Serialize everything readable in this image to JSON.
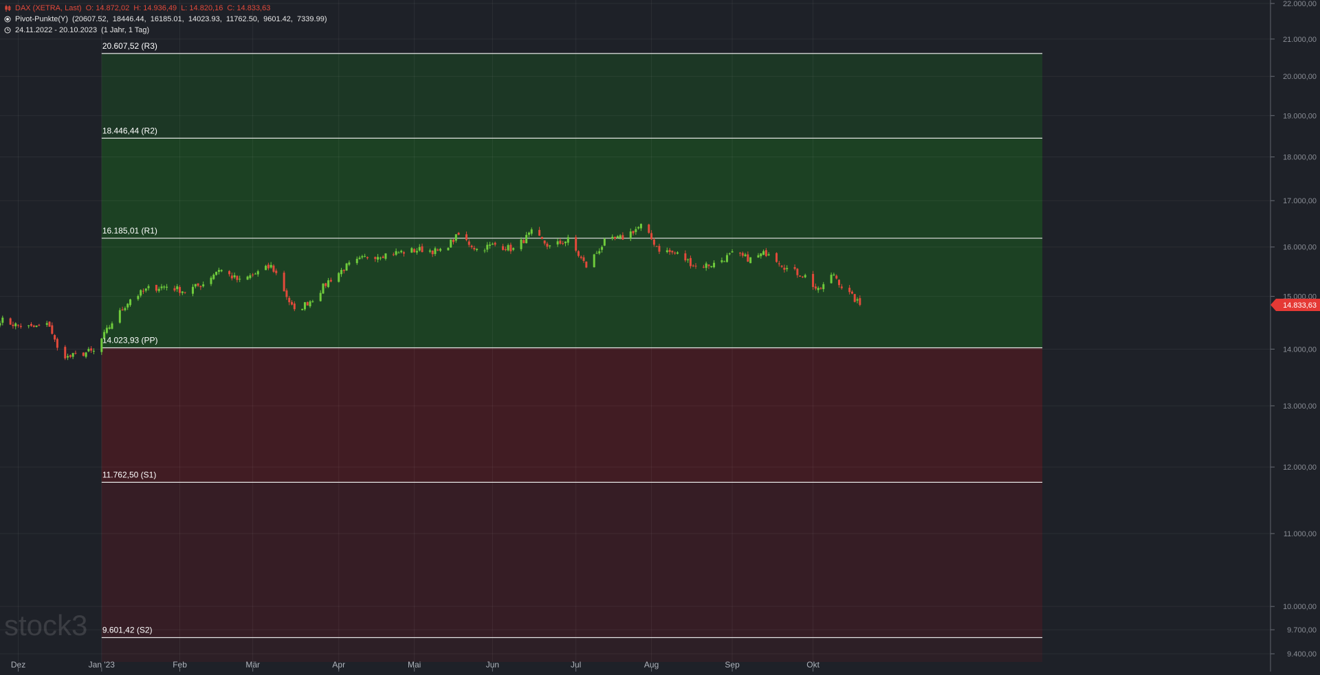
{
  "legend": {
    "instrument": "DAX (XETRA, Last)",
    "open": "O: 14.872,02",
    "high": "H: 14.936,49",
    "low": "L: 14.820,16",
    "close": "C: 14.833,63",
    "indicator": "Pivot-Punkte(Y)",
    "indicator_values": "(20607.52,  18446.44,  16185.01,  14023.93,  11762.50,  9601.42,  7339.99)",
    "range": "24.11.2022 - 20.10.2023",
    "range_detail": "(1 Jahr, 1 Tag)"
  },
  "watermark": "stock3",
  "colors": {
    "background": "#1e2128",
    "up": "#6fcb3c",
    "down": "#e24a3b",
    "resistance_zone": "#1c4a22",
    "support_zone": "#4a1c22"
  },
  "chart_data": {
    "type": "candlestick",
    "y_scale": "log",
    "ylim": [
      9300,
      22100
    ],
    "yticks": [
      {
        "value": 9400,
        "label": "9.400,00"
      },
      {
        "value": 9700,
        "label": "9.700,00"
      },
      {
        "value": 10000,
        "label": "10.000,00"
      },
      {
        "value": 11000,
        "label": "11.000,00"
      },
      {
        "value": 12000,
        "label": "12.000,00"
      },
      {
        "value": 13000,
        "label": "13.000,00"
      },
      {
        "value": 14000,
        "label": "14.000,00"
      },
      {
        "value": 15000,
        "label": "15.000,00"
      },
      {
        "value": 16000,
        "label": "16.000,00"
      },
      {
        "value": 17000,
        "label": "17.000,00"
      },
      {
        "value": 18000,
        "label": "18.000,00"
      },
      {
        "value": 19000,
        "label": "19.000,00"
      },
      {
        "value": 20000,
        "label": "20.000,00"
      },
      {
        "value": 21000,
        "label": "21.000,00"
      },
      {
        "value": 22000,
        "label": "22.000,00"
      }
    ],
    "xlim": [
      "2022-11-24",
      "2024-03-15"
    ],
    "xticks": [
      {
        "date": "2022-12-01",
        "label": "Dez"
      },
      {
        "date": "2023-01-02",
        "label": "Jan '23"
      },
      {
        "date": "2023-02-01",
        "label": "Feb"
      },
      {
        "date": "2023-03-01",
        "label": "Mär"
      },
      {
        "date": "2023-04-03",
        "label": "Apr"
      },
      {
        "date": "2023-05-02",
        "label": "Mai"
      },
      {
        "date": "2023-06-01",
        "label": "Jun"
      },
      {
        "date": "2023-07-03",
        "label": "Jul"
      },
      {
        "date": "2023-08-01",
        "label": "Aug"
      },
      {
        "date": "2023-09-01",
        "label": "Sep"
      },
      {
        "date": "2023-10-02",
        "label": "Okt"
      }
    ],
    "last_price": {
      "value": 14833.63,
      "label": "14.833,63"
    },
    "pivot_period": [
      "2023-01-02",
      "2023-12-29"
    ],
    "pivots": [
      {
        "value": 20607.52,
        "label": "20.607,52 (R3)"
      },
      {
        "value": 18446.44,
        "label": "18.446,44 (R2)"
      },
      {
        "value": 16185.01,
        "label": "16.185,01 (R1)"
      },
      {
        "value": 14023.93,
        "label": "14.023,93 (PP)"
      },
      {
        "value": 11762.5,
        "label": "11.762,50 (S1)"
      },
      {
        "value": 9601.42,
        "label": "9.601,42 (S2)"
      }
    ],
    "series": [
      {
        "date": "2022-11-24",
        "close": 14550
      },
      {
        "date": "2022-11-30",
        "close": 14450
      },
      {
        "date": "2022-12-06",
        "close": 14400
      },
      {
        "date": "2022-12-13",
        "close": 14450
      },
      {
        "date": "2022-12-16",
        "close": 14000
      },
      {
        "date": "2022-12-20",
        "close": 13850
      },
      {
        "date": "2022-12-28",
        "close": 13950
      },
      {
        "date": "2022-12-30",
        "close": 13950
      },
      {
        "date": "2023-01-06",
        "close": 14500
      },
      {
        "date": "2023-01-10",
        "close": 14750
      },
      {
        "date": "2023-01-13",
        "close": 14950
      },
      {
        "date": "2023-01-20",
        "close": 15150
      },
      {
        "date": "2023-01-27",
        "close": 15200
      },
      {
        "date": "2023-02-03",
        "close": 15100
      },
      {
        "date": "2023-02-10",
        "close": 15250
      },
      {
        "date": "2023-02-16",
        "close": 15550
      },
      {
        "date": "2023-02-24",
        "close": 15300
      },
      {
        "date": "2023-03-02",
        "close": 15450
      },
      {
        "date": "2023-03-08",
        "close": 15600
      },
      {
        "date": "2023-03-10",
        "close": 15450
      },
      {
        "date": "2023-03-15",
        "close": 14900
      },
      {
        "date": "2023-03-17",
        "close": 14700
      },
      {
        "date": "2023-03-24",
        "close": 14950
      },
      {
        "date": "2023-03-30",
        "close": 15300
      },
      {
        "date": "2023-04-06",
        "close": 15600
      },
      {
        "date": "2023-04-14",
        "close": 15800
      },
      {
        "date": "2023-04-21",
        "close": 15850
      },
      {
        "date": "2023-04-28",
        "close": 15900
      },
      {
        "date": "2023-05-05",
        "close": 15950
      },
      {
        "date": "2023-05-12",
        "close": 15900
      },
      {
        "date": "2023-05-19",
        "close": 16250
      },
      {
        "date": "2023-05-26",
        "close": 15950
      },
      {
        "date": "2023-06-02",
        "close": 16050
      },
      {
        "date": "2023-06-09",
        "close": 15950
      },
      {
        "date": "2023-06-16",
        "close": 16300
      },
      {
        "date": "2023-06-23",
        "close": 16000
      },
      {
        "date": "2023-06-30",
        "close": 16150
      },
      {
        "date": "2023-07-07",
        "close": 15600
      },
      {
        "date": "2023-07-14",
        "close": 16100
      },
      {
        "date": "2023-07-21",
        "close": 16200
      },
      {
        "date": "2023-07-28",
        "close": 16450
      },
      {
        "date": "2023-08-04",
        "close": 15950
      },
      {
        "date": "2023-08-11",
        "close": 15850
      },
      {
        "date": "2023-08-18",
        "close": 15600
      },
      {
        "date": "2023-08-25",
        "close": 15650
      },
      {
        "date": "2023-09-01",
        "close": 15850
      },
      {
        "date": "2023-09-08",
        "close": 15750
      },
      {
        "date": "2023-09-15",
        "close": 15900
      },
      {
        "date": "2023-09-22",
        "close": 15550
      },
      {
        "date": "2023-09-29",
        "close": 15400
      },
      {
        "date": "2023-10-04",
        "close": 15100
      },
      {
        "date": "2023-10-10",
        "close": 15450
      },
      {
        "date": "2023-10-13",
        "close": 15200
      },
      {
        "date": "2023-10-20",
        "close": 14833.63
      }
    ]
  }
}
